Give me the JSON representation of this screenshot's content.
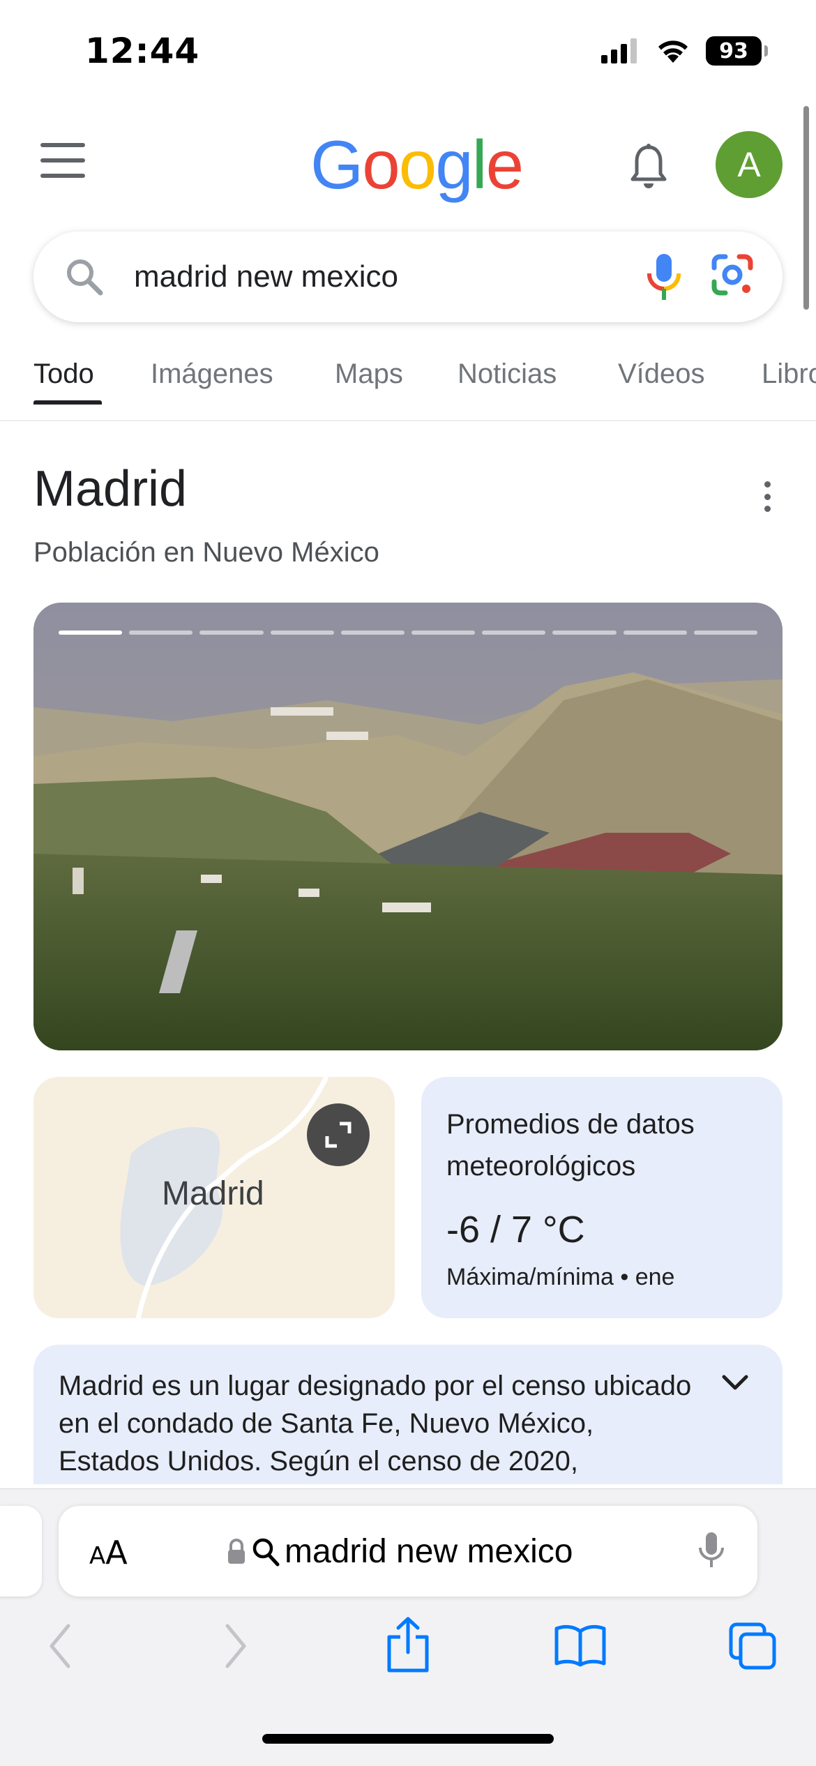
{
  "status_bar": {
    "time": "12:44",
    "battery": "93"
  },
  "google": {
    "logo": "Google",
    "avatar_letter": "A",
    "search": {
      "query": "madrid new mexico"
    },
    "tabs": [
      "Todo",
      "Imágenes",
      "Maps",
      "Noticias",
      "Vídeos",
      "Libros"
    ],
    "active_tab": "Todo"
  },
  "knowledge_panel": {
    "title": "Madrid",
    "subtitle": "Población en Nuevo México",
    "photo_slides": 10,
    "photo_active_slide": 1,
    "map_label": "Madrid",
    "weather": {
      "title": "Promedios de datos meteorológicos",
      "temp": "-6 / 7 °C",
      "sub": "Máxima/mínima • ene"
    },
    "description": "Madrid es un lugar designado por el censo ubicado en el condado de Santa Fe, Nuevo México, Estados Unidos. Según el censo de 2020,"
  },
  "safari": {
    "aa_label": "AA",
    "url_text": "madrid new mexico"
  },
  "colors": {
    "google_blue": "#4285F4",
    "google_red": "#EA4335",
    "google_yellow": "#FBBC05",
    "google_green": "#34A853",
    "avatar_green": "#5f9e33",
    "ios_blue": "#007AFF",
    "card_tint": "#e7edfa"
  }
}
